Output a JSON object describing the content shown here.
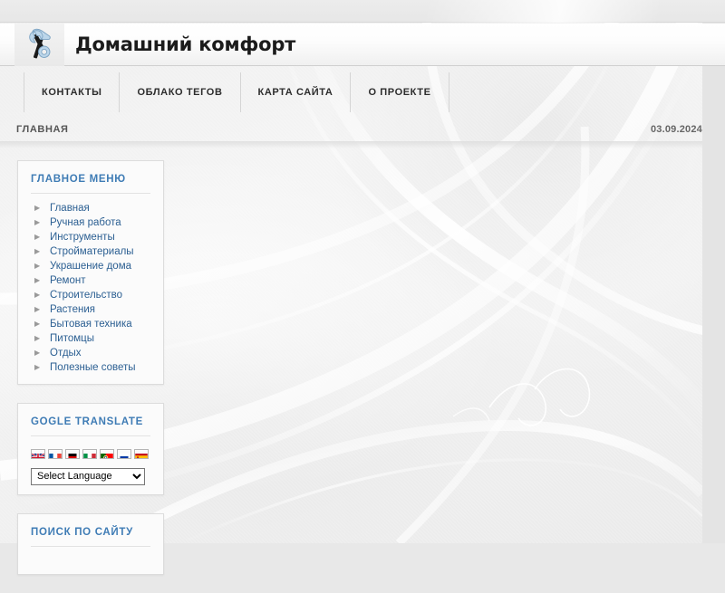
{
  "site": {
    "title": "Домашний комфорт",
    "logo_icon": "hammer-wrench-icon"
  },
  "topnav": {
    "items": [
      {
        "label": "КОНТАКТЫ"
      },
      {
        "label": "ОБЛАКО ТЕГОВ"
      },
      {
        "label": "КАРТА САЙТА"
      },
      {
        "label": "О ПРОЕКТЕ"
      }
    ]
  },
  "breadcrumb": {
    "current": "ГЛАВНАЯ",
    "date": "03.09.2024"
  },
  "sidebar": {
    "main_menu": {
      "title": "ГЛАВНОЕ МЕНЮ",
      "items": [
        {
          "label": "Главная",
          "marker": "arrow-right-icon"
        },
        {
          "label": "Ручная работа",
          "marker": "arrow-right-icon"
        },
        {
          "label": "Инструменты",
          "marker": "arrow-right-icon"
        },
        {
          "label": "Стройматериалы",
          "marker": "arrow-right-icon"
        },
        {
          "label": "Украшение дома",
          "marker": "arrow-right-icon"
        },
        {
          "label": "Ремонт",
          "marker": "arrow-right-icon"
        },
        {
          "label": "Строительство",
          "marker": "arrow-right-icon"
        },
        {
          "label": "Растения",
          "marker": "arrow-right-icon"
        },
        {
          "label": "Бытовая техника",
          "marker": "arrow-right-icon"
        },
        {
          "label": "Питомцы",
          "marker": "arrow-right-icon"
        },
        {
          "label": "Отдых",
          "marker": "arrow-right-icon"
        },
        {
          "label": "Полезные советы",
          "marker": "arrow-right-icon"
        }
      ]
    },
    "translate": {
      "title": "GOGLE TRANSLATE",
      "flags": [
        {
          "name": "flag-united-kingdom"
        },
        {
          "name": "flag-france"
        },
        {
          "name": "flag-germany"
        },
        {
          "name": "flag-italy"
        },
        {
          "name": "flag-portugal"
        },
        {
          "name": "flag-russia"
        },
        {
          "name": "flag-spain"
        }
      ],
      "select_value": "Select Language",
      "select_options": [
        "Select Language"
      ]
    },
    "search": {
      "title": "ПОИСК ПО САЙТУ"
    }
  },
  "colors": {
    "panel_title": "#3f7cb5",
    "menu_link": "#2b5f92",
    "page_bg": "#e9e9e9",
    "panel_bg": "#fbfbfb"
  }
}
